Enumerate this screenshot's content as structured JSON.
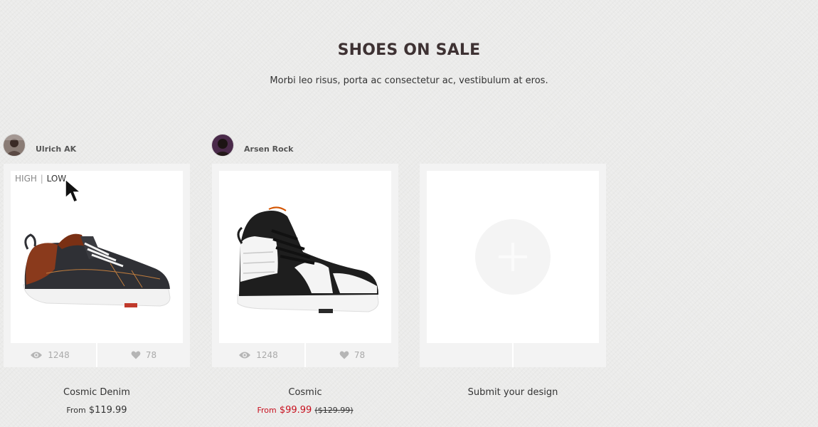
{
  "header": {
    "title": "SHOES ON SALE",
    "subtitle": "Morbi leo risus, porta ac consectetur ac, vestibulum at eros."
  },
  "toggle": {
    "high": "HIGH",
    "separator": "|",
    "low": "LOW"
  },
  "products": [
    {
      "author": "Ulrich AK",
      "views": "1248",
      "likes": "78",
      "name": "Cosmic Denim",
      "from_label": "From",
      "price": "$119.99"
    },
    {
      "author": "Arsen Rock",
      "views": "1248",
      "likes": "78",
      "name": "Cosmic",
      "from_label": "From",
      "price": "$99.99",
      "old_price": "($129.99)"
    }
  ],
  "submit": {
    "label": "Submit your design"
  },
  "colors": {
    "sale": "#c8101e",
    "title": "#3e3233",
    "background": "#ebebea"
  }
}
